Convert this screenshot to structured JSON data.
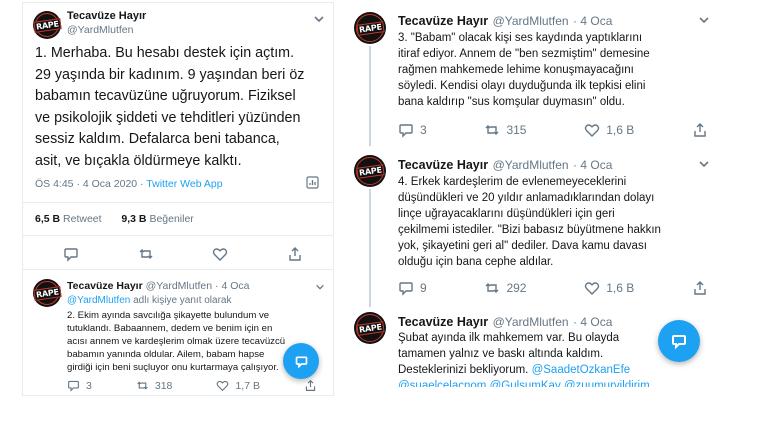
{
  "left": {
    "main_tweet": {
      "name": "Tecavüze Hayır",
      "handle": "@YardMlutfen",
      "avatar_text": "RAPE",
      "text_lines": [
        "1.  Merhaba. Bu hesabı destek için açtım.",
        "29 yaşında bir kadınım. 9 yaşından beri öz",
        "babamın tecavüzüne uğruyorum. Fiziksel",
        "ve psikolojik şiddeti ve tehditleri yüzünden",
        "sessiz kaldım. Defalarca beni tabanca,",
        "asit, ve bıçakla öldürmeye kalktı."
      ],
      "time": "ÖS 4:45 · 4 Oca 2020 · ",
      "source": "Twitter Web App",
      "retweets_count": "6,5 B",
      "retweets_label": "Retweet",
      "likes_count": "9,3 B",
      "likes_label": "Beğeniler"
    },
    "reply": {
      "name": "Tecavüze Hayır",
      "handle": "@YardMlutfen",
      "date": "· 4 Oca",
      "avatar_text": "RAPE",
      "reply_to_handle": "@YardMlutfen",
      "reply_to_suffix": " adlı kişiye yanıt olarak",
      "text_lines": [
        "2. Ekim ayında savcılığa şikayette bulundum ve",
        "tutuklandı. Babaannem, dedem ve benim için en",
        "acısı annem ve kardeşlerim olmak üzere tecavüzcü",
        "babamın yanında oldular. Ailem, babam hapse",
        "girdiği için beni suçluyor onu kurtarmaya çalışıyor."
      ],
      "replies": "3",
      "retweets": "318",
      "likes": "1,7 B"
    }
  },
  "right": {
    "tweets": [
      {
        "name": "Tecavüze Hayır",
        "handle": "@YardMlutfen",
        "date": "· 4 Oca",
        "avatar_text": "RAPE",
        "text_lines": [
          "3. \"Babam\" olacak kişi ses kaydında yaptıklarını",
          "itiraf ediyor. Annem de \"ben sezmiştim\" demesine",
          "rağmen mahkemede lehime konuşmayacağını",
          "söyledi. Kendisi olayı duyduğunda ilk tepkisi elini",
          "bana kaldırıp \"sus komşular duymasın\" oldu."
        ],
        "replies": "3",
        "retweets": "315",
        "likes": "1,6 B"
      },
      {
        "name": "Tecavüze Hayır",
        "handle": "@YardMlutfen",
        "date": "· 4 Oca",
        "avatar_text": "RAPE",
        "text_lines": [
          "4. Erkek kardeşlerim de evlenemeyeceklerini",
          "düşündükleri ve 20 yıldır anlamadıklarından dolayı",
          "linçe uğrayacaklarını düşündükleri için geri",
          "çekilmemi istediler. \"Bizi babasız büyütmene hakkın",
          "yok, şikayetini geri al\" dediler. Dava kamu davası",
          "olduğu için bana cephe aldılar."
        ],
        "replies": "9",
        "retweets": "292",
        "likes": "1,6 B"
      },
      {
        "name": "Tecavüze Hayır",
        "handle": "@YardMlutfen",
        "date": "· 4 Oca",
        "avatar_text": "RAPE",
        "text_lines": [
          "Şubat ayında ilk mahkemem var. Bu olayda",
          "tamamen yalnız ve baskı altında kaldım.",
          "Desteklerinizi bekliyorum. "
        ],
        "mention": "@SaadetOzkanEfe",
        "mentions_line": "@suaelcelacnom @GulsumKav @zuumurvildirim"
      }
    ]
  },
  "colors": {
    "link": "#1da1f2",
    "muted": "#657786",
    "text": "#14171a",
    "fab": "#1da1f2"
  },
  "icons": [
    "reply-icon",
    "retweet-icon",
    "like-icon",
    "share-icon",
    "compose-icon",
    "chevron-down-icon",
    "chart-icon"
  ]
}
